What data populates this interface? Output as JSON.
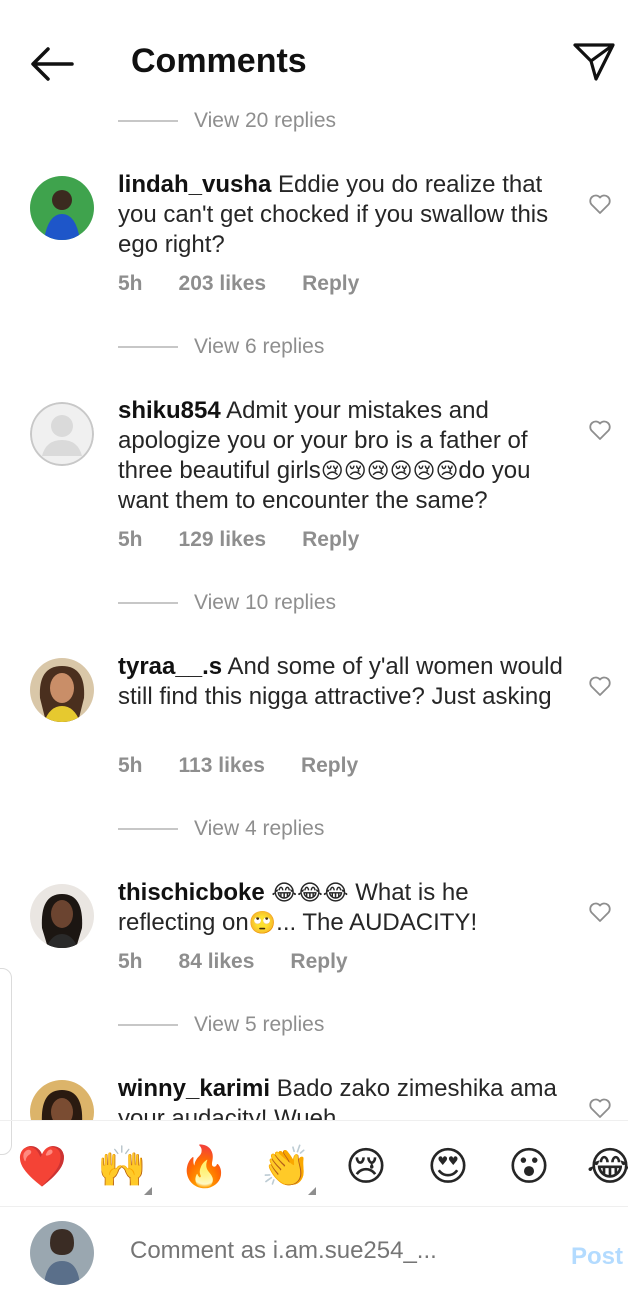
{
  "header": {
    "title": "Comments"
  },
  "view_replies": [
    "View 20 replies",
    "View 6 replies",
    "View 10 replies",
    "View 4 replies",
    "View 5 replies"
  ],
  "comments": [
    {
      "username": "lindah_vusha",
      "text": "Eddie you do realize that you can't get chocked if you swallow this ego right?",
      "time": "5h",
      "likes": "203 likes",
      "reply": "Reply"
    },
    {
      "username": "shiku854",
      "text": "Admit your mistakes and apologize you or your bro is a father of three beautiful girls",
      "emoji": "😢😢😢😢😢😢",
      "text_after": "do you want them to encounter the same?",
      "time": "5h",
      "likes": "129 likes",
      "reply": "Reply"
    },
    {
      "username": "tyraa__.s",
      "text": "And some of y'all women would still find this nigga attractive? Just asking",
      "time": "5h",
      "likes": "113 likes",
      "reply": "Reply"
    },
    {
      "username": "thischicboke",
      "emoji": "😂😂😂",
      "text": "What is he reflecting on",
      "emoji2": "🙄",
      "text_after": "... The AUDACITY!",
      "time": "5h",
      "likes": "84 likes",
      "reply": "Reply"
    },
    {
      "username": "winny_karimi",
      "text": "Bado zako zimeshika ama your audacity! Wueh"
    }
  ],
  "emoji_bar": [
    "❤️",
    "🙌",
    "🔥",
    "👏",
    "😢",
    "😍",
    "😮",
    "😂"
  ],
  "compose": {
    "placeholder": "Comment as i.am.sue254_...",
    "post_label": "Post"
  },
  "colors": {
    "text": "#262626",
    "muted": "#8e8e8e",
    "post_disabled": "#b3dbff"
  },
  "icons": [
    "back-arrow-icon",
    "send-icon",
    "heart-outline-icon"
  ]
}
